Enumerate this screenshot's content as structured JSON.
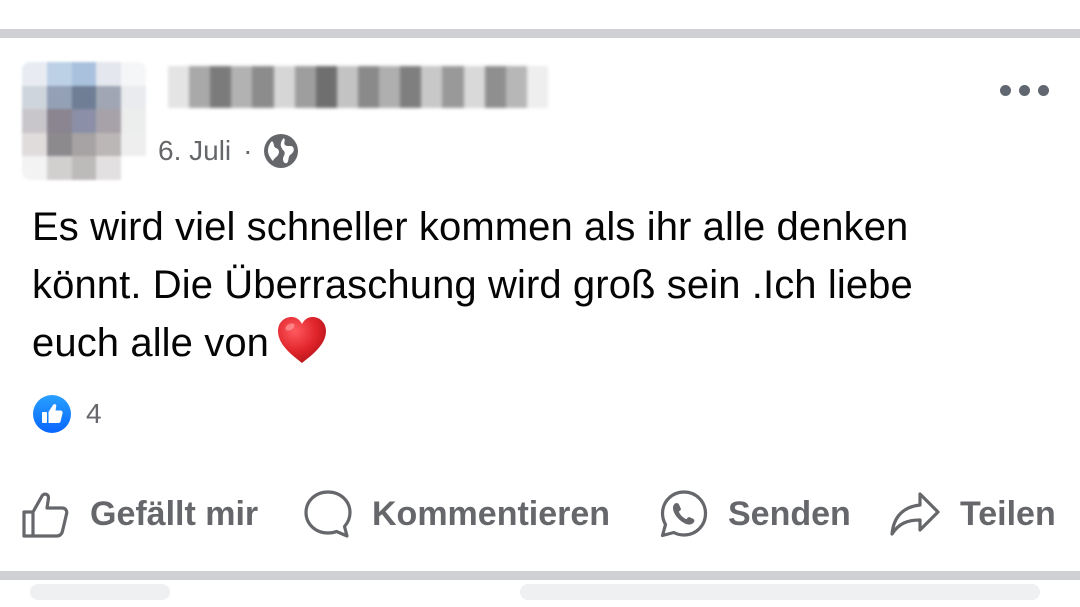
{
  "post": {
    "date": "6. Juli",
    "separator": "·",
    "privacy_icon": "globe-icon",
    "menu_icon": "more-horizontal-icon",
    "text_lines": [
      "Es wird viel schneller kommen als ihr alle denken",
      "könnt. Die Überraschung wird groß sein .Ich liebe",
      "euch alle von"
    ],
    "emoji": "red-heart"
  },
  "reactions": {
    "icon": "like-badge-icon",
    "count": "4"
  },
  "actions": {
    "like_label": "Gefällt mir",
    "comment_label": "Kommentieren",
    "send_label": "Senden",
    "share_label": "Teilen"
  },
  "colors": {
    "divider": "#ced0d4",
    "secondary_text": "#65676b",
    "primary_text": "#050505",
    "like_blue": "#1877f2",
    "heart_red": "#e0242b"
  }
}
